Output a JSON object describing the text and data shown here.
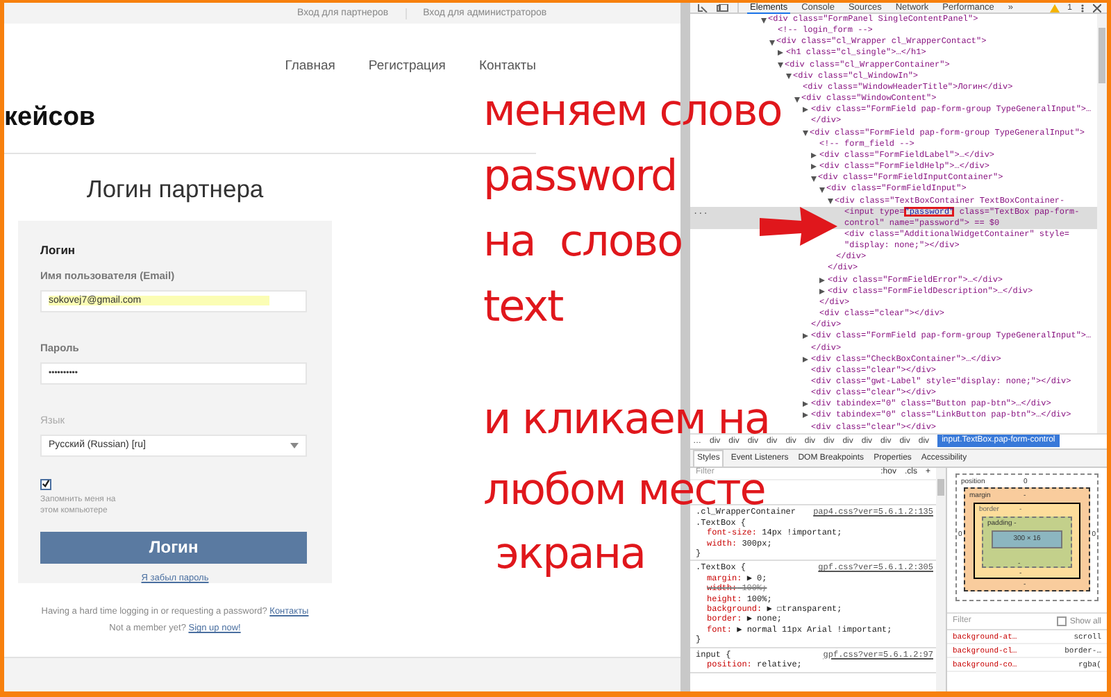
{
  "page": {
    "top_links": [
      "Вход для партнеров",
      "Вход для администраторов"
    ],
    "nav": [
      "Главная",
      "Регистрация",
      "Контакты"
    ],
    "brand": "кейсов",
    "heading": "Логин партнера",
    "form": {
      "title": "Логин",
      "email_label": "Имя пользователя (Email)",
      "email_value": "sokovej7@gmail.com",
      "password_label": "Пароль",
      "password_value": "••••••••••",
      "language_label": "Язык",
      "language_value": "Русский (Russian) [ru]",
      "remember": {
        "label": "Запомнить меня на этом компьютере",
        "checked": true
      },
      "submit": "Логин",
      "forgot": "Я забыл пароль"
    },
    "help_text": "Having a hard time logging in or requesting a password?",
    "help_link": "Контакты",
    "signup_text": "Not a member yet?",
    "signup_link": "Sign up now!"
  },
  "annotations": [
    {
      "lines": [
        "меняем слово",
        "password",
        "на  слово",
        "text"
      ]
    },
    {
      "lines": [
        "и кликаем на",
        "любом месте",
        " экрана"
      ]
    }
  ],
  "devtools": {
    "tabs": [
      {
        "label": "Elements",
        "selected": true
      },
      {
        "label": "Console",
        "selected": false
      },
      {
        "label": "Sources",
        "selected": false
      },
      {
        "label": "Network",
        "selected": false
      },
      {
        "label": "Performance",
        "selected": false
      },
      {
        "label": "»",
        "selected": false
      }
    ],
    "warning_count": "1",
    "dom_tree": [
      {
        "text": "<div class=\"FormPanel SingleContentPanel\">",
        "expanded": true,
        "selected": false,
        "children": [
          {
            "text": "<!-- login_form -->",
            "selected": false
          },
          {
            "text": "<div class=\"cl_Wrapper cl_WrapperContact\">",
            "expanded": true,
            "selected": false,
            "children": [
              {
                "text": "<h1 class=\"cl_single\">…</h1>",
                "expanded": false,
                "selected": false
              },
              {
                "text": "<div class=\"cl_WrapperContainer\">",
                "expanded": true,
                "selected": false,
                "children": [
                  {
                    "text": "<div class=\"cl_WindowIn\">",
                    "expanded": true,
                    "selected": false,
                    "children": [
                      {
                        "text": "<div class=\"WindowHeaderTitle\">Логин</div>",
                        "selected": false
                      },
                      {
                        "text": "<div class=\"WindowContent\">",
                        "expanded": true,
                        "selected": false,
                        "children": [
                          {
                            "text": "<div class=\"FormField pap-form-group TypeGeneralInput\">…",
                            "expanded": false,
                            "selected": false
                          },
                          {
                            "text": "</div>",
                            "selected": false
                          },
                          {
                            "text": "<div class=\"FormField pap-form-group TypeGeneralInput\">",
                            "expanded": true,
                            "selected": false,
                            "children": [
                              {
                                "text": "<!-- form_field -->",
                                "selected": false
                              },
                              {
                                "text": "<div class=\"FormFieldLabel\">…</div>",
                                "expanded": false,
                                "selected": false
                              },
                              {
                                "text": "<div class=\"FormFieldHelp\">…</div>",
                                "expanded": false,
                                "selected": false
                              },
                              {
                                "text": "<div class=\"FormFieldInputContainer\">",
                                "expanded": true,
                                "selected": false,
                                "children": [
                                  {
                                    "text": "<div class=\"FormFieldInput\">",
                                    "expanded": true,
                                    "selected": false,
                                    "children": [
                                      {
                                        "text": "<div class=\"TextBoxContainer TextBoxContainer-",
                                        "expanded": true,
                                        "selected": false,
                                        "children": [
                                          {
                                            "gutter": "...",
                                            "text_before": "<input type=",
                                            "marked": "\"password\"",
                                            "text_after": " class=\"TextBox pap-form-control\" name=\"password\"> == $0",
                                            "selected": true
                                          },
                                          {
                                            "text": "<div class=\"AdditionalWidgetContainer\" style= \"display: none;\"></div>",
                                            "selected": false
                                          }
                                        ]
                                      },
                                      {
                                        "text": "</div>",
                                        "selected": false
                                      }
                                    ]
                                  },
                                  {
                                    "text": "</div>",
                                    "selected": false
                                  },
                                  {
                                    "text": "<div class=\"FormFieldError\">…</div>",
                                    "expanded": false,
                                    "selected": false
                                  },
                                  {
                                    "text": "<div class=\"FormFieldDescription\">…</div>",
                                    "expanded": false,
                                    "selected": false
                                  }
                                ]
                              },
                              {
                                "text": "</div>",
                                "selected": false
                              },
                              {
                                "text": "<div class=\"clear\"></div>",
                                "selected": false
                              }
                            ]
                          },
                          {
                            "text": "</div>",
                            "selected": false
                          },
                          {
                            "text": "<div class=\"FormField pap-form-group TypeGeneralInput\">…",
                            "expanded": false,
                            "selected": false
                          },
                          {
                            "text": "</div>",
                            "selected": false
                          },
                          {
                            "text": "<div class=\"CheckBoxContainer\">…</div>",
                            "expanded": false,
                            "selected": false
                          },
                          {
                            "text": "<div class=\"clear\"></div>",
                            "selected": false
                          },
                          {
                            "text": "<div class=\"gwt-Label\" style=\"display: none;\"></div>",
                            "selected": false
                          },
                          {
                            "text": "<div class=\"clear\"></div>",
                            "selected": false
                          },
                          {
                            "text": "<div tabindex=\"0\" class=\"Button pap-btn\">…</div>",
                            "expanded": false,
                            "selected": false
                          },
                          {
                            "text": "<div tabindex=\"0\" class=\"LinkButton pap-btn\">…</div>",
                            "expanded": false,
                            "selected": false
                          },
                          {
                            "text": "<div class=\"clear\"></div>",
                            "selected": false
                          }
                        ]
                      }
                    ]
                  }
                ]
              }
            ]
          }
        ]
      }
    ],
    "breadcrumb": [
      {
        "label": "…",
        "selected": false
      },
      {
        "label": "div",
        "selected": false
      },
      {
        "label": "div",
        "selected": false
      },
      {
        "label": "div",
        "selected": false
      },
      {
        "label": "div",
        "selected": false
      },
      {
        "label": "div",
        "selected": false
      },
      {
        "label": "div",
        "selected": false
      },
      {
        "label": "div",
        "selected": false
      },
      {
        "label": "div",
        "selected": false
      },
      {
        "label": "div",
        "selected": false
      },
      {
        "label": "div",
        "selected": false
      },
      {
        "label": "div",
        "selected": false
      },
      {
        "label": "div",
        "selected": false
      },
      {
        "label": "input.TextBox.pap-form-control",
        "selected": true
      }
    ],
    "panel_tabs": [
      {
        "label": "Styles",
        "selected": true
      },
      {
        "label": "Event Listeners",
        "selected": false
      },
      {
        "label": "DOM Breakpoints",
        "selected": false
      },
      {
        "label": "Properties",
        "selected": false
      },
      {
        "label": "Accessibility",
        "selected": false
      }
    ],
    "styles": {
      "filter_placeholder": "Filter",
      "controls": [
        ":hov",
        ".cls",
        "+"
      ],
      "rules": [
        {
          "selectors": [
            ".cl_WrapperContainer",
            ".TextBox {"
          ],
          "source": "pap4.css?ver=5.6.1.2:135",
          "declarations": [
            {
              "name": "font-size:",
              "value": "14px !important;",
              "overridden": false
            },
            {
              "name": "width:",
              "value": "300px;",
              "overridden": false
            }
          ],
          "closing": "}"
        },
        {
          "selectors": [
            ".TextBox {"
          ],
          "source": "gpf.css?ver=5.6.1.2:305",
          "declarations": [
            {
              "name": "margin:",
              "value": "▶ 0;",
              "overridden": false
            },
            {
              "name": "width:",
              "value": "100%;",
              "overridden": true
            },
            {
              "name": "height:",
              "value": "100%;",
              "overridden": false
            },
            {
              "name": "background:",
              "value": "▶ ☐transparent;",
              "overridden": false
            },
            {
              "name": "border:",
              "value": "▶ none;",
              "overridden": false
            },
            {
              "name": "font:",
              "value": "▶ normal 11px Arial !important;",
              "overridden": false
            }
          ],
          "closing": "}"
        },
        {
          "selectors": [
            "input {"
          ],
          "source": "gpf.css?ver=5.6.1.2:97",
          "declarations": [
            {
              "name": "position:",
              "value": "relative;",
              "overridden": false
            }
          ]
        }
      ]
    },
    "box_model": {
      "position_label": "position",
      "position_value": "0",
      "margin_label": "margin",
      "margin_value": "-",
      "border_label": "border",
      "border_value": "-",
      "padding_label": "padding",
      "padding_value": "-",
      "content": "300 × 16",
      "left_value": "0",
      "right_value": "0",
      "padding_bottom": "-",
      "border_bottom": "-",
      "margin_bottom": "-"
    },
    "computed": {
      "filter_placeholder": "Filter",
      "show_all": {
        "label": "Show all",
        "checked": false
      },
      "rows": [
        {
          "name": "background-at…",
          "value": "scroll"
        },
        {
          "name": "background-cl…",
          "value": "border-…"
        },
        {
          "name": "background-co…",
          "value": "rgba("
        }
      ]
    }
  }
}
